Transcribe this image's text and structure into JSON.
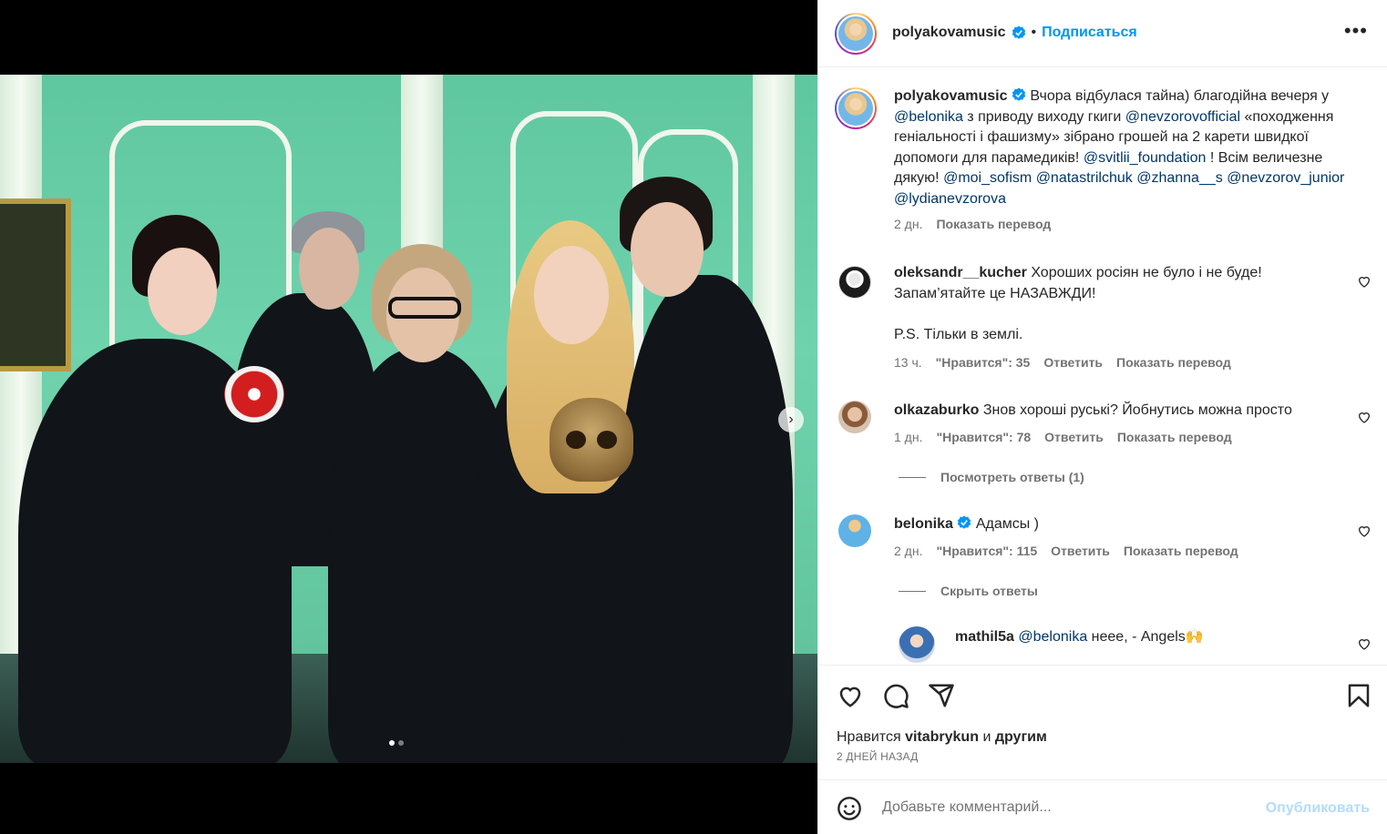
{
  "post": {
    "author": "polyakovamusic",
    "follow_label": "Подписаться",
    "more_icon": "more-horizontal-icon",
    "caption_author": "polyakovamusic",
    "caption_parts": [
      {
        "t": "Вчора відбулася тайна) благодійна вечеря у ",
        "m": false
      },
      {
        "t": "@belonika",
        "m": true
      },
      {
        "t": " з приводу виходу гкиги ",
        "m": false
      },
      {
        "t": "@nevzorovofficial",
        "m": true
      },
      {
        "t": " «походження геніальності і фашизму» зібрано грошей на 2 карети швидкої допомоги для парамедиків! ",
        "m": false
      },
      {
        "t": "@svitlii_foundation",
        "m": true
      },
      {
        "t": " ! Всім величезне дякую! ",
        "m": false
      },
      {
        "t": "@moi_sofism",
        "m": true
      },
      {
        "t": " ",
        "m": false
      },
      {
        "t": "@natastrilchuk",
        "m": true
      },
      {
        "t": " ",
        "m": false
      },
      {
        "t": "@zhanna__s",
        "m": true
      },
      {
        "t": " ",
        "m": false
      },
      {
        "t": "@nevzorov_junior",
        "m": true
      },
      {
        "t": " ",
        "m": false
      },
      {
        "t": "@lydianevzorova",
        "m": true
      }
    ],
    "caption_time": "2 дн.",
    "caption_translate": "Показать перевод"
  },
  "comments": [
    {
      "user": "oleksandr__kucher",
      "text_line1": "Хороших росіян не було і не буде!",
      "text_line2": "Запам’ятайте це НАЗАВЖДИ!",
      "text_line3": "P.S. Тільки в землі.",
      "time": "13 ч.",
      "likes": "\"Нравится\": 35",
      "reply": "Ответить",
      "translate": "Показать перевод"
    },
    {
      "user": "olkazaburko",
      "text": "Знов хороші руські? Йобнутись можна просто",
      "time": "1 дн.",
      "likes": "\"Нравится\": 78",
      "reply": "Ответить",
      "translate": "Показать перевод",
      "replies_toggle": "Посмотреть ответы (1)"
    },
    {
      "user": "belonika",
      "text": "Адамсы )",
      "time": "2 дн.",
      "likes": "\"Нравится\": 115",
      "reply": "Ответить",
      "translate": "Показать перевод",
      "replies_toggle": "Скрыть ответы"
    },
    {
      "user": "mathil5a",
      "mention": "@belonika",
      "text": " неее, - Angels🙌"
    }
  ],
  "actions": {
    "like_icon": "heart-icon",
    "comment_icon": "comment-icon",
    "share_icon": "share-icon",
    "save_icon": "bookmark-icon"
  },
  "likes": {
    "prefix": "Нравится",
    "user": "vitabrykun",
    "joiner": "и",
    "others": "другим"
  },
  "date": "2 ДНЕЙ НАЗАД",
  "add_comment": {
    "placeholder": "Добавьте комментарий...",
    "publish": "Опубликовать",
    "emoji_icon": "emoji-icon"
  },
  "carousel": {
    "total": 2,
    "active": 1,
    "next_icon": "chevron-right-icon"
  },
  "colors": {
    "link": "#0095f6",
    "mention": "#00376b",
    "muted": "#737373"
  }
}
